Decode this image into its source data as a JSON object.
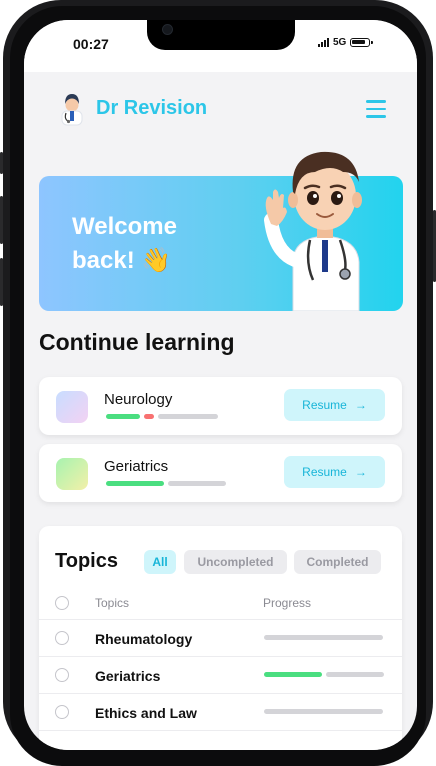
{
  "status_bar": {
    "time": "00:27",
    "network": "5G"
  },
  "header": {
    "brand": "Dr Revision",
    "menu_icon": "hamburger-icon"
  },
  "hero": {
    "greeting": "Welcome",
    "greeting2": "back! 👋"
  },
  "continue_learning": {
    "title": "Continue learning",
    "resume_label": "Resume",
    "courses": [
      {
        "name": "Neurology",
        "progress": [
          {
            "color": "#4ade80",
            "fraction": 0.28
          },
          {
            "color": "#f87171",
            "fraction": 0.08
          },
          {
            "color": "#d4d4d8",
            "fraction": 0.5
          }
        ]
      },
      {
        "name": "Geriatrics",
        "progress": [
          {
            "color": "#4ade80",
            "fraction": 0.48
          },
          {
            "color": "#d4d4d8",
            "fraction": 0.48
          }
        ]
      }
    ]
  },
  "topics": {
    "title": "Topics",
    "filters": {
      "all": "All",
      "uncompleted": "Uncompleted",
      "completed": "Completed",
      "active": "All"
    },
    "columns": {
      "topic": "Topics",
      "progress": "Progress"
    },
    "rows": [
      {
        "name": "Rheumatology",
        "completed_fraction": 0.0
      },
      {
        "name": "Geriatrics",
        "completed_fraction": 0.5
      },
      {
        "name": "Ethics and Law",
        "completed_fraction": 0.0
      }
    ]
  },
  "colors": {
    "accent": "#2cc6e8",
    "accent_bg": "#cff5fb",
    "success": "#4ade80",
    "error": "#f87171",
    "track": "#d4d4d8"
  }
}
